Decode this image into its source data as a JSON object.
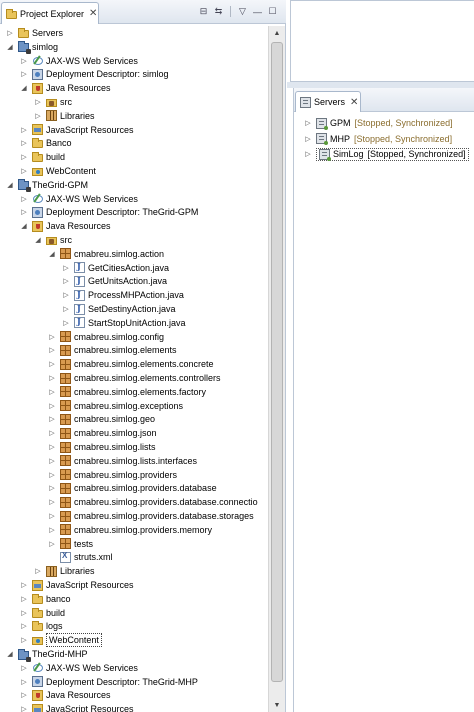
{
  "project_explorer": {
    "tab_label": "Project Explorer",
    "close_glyph": "✕",
    "toolbar": {
      "collapse_all": "⊟",
      "link_with_editor": "⇆",
      "view_menu": "▽",
      "minimize": "—",
      "maximize": "☐"
    },
    "tree": [
      {
        "depth": 0,
        "label": "Servers",
        "icon": "folder-icon",
        "expand": "collapsed"
      },
      {
        "depth": 0,
        "label": "simlog",
        "icon": "project-icon",
        "expand": "expanded"
      },
      {
        "depth": 1,
        "label": "JAX-WS Web Services",
        "icon": "web-services-icon",
        "expand": "collapsed"
      },
      {
        "depth": 1,
        "label": "Deployment Descriptor: simlog",
        "icon": "deployment-descriptor-icon",
        "expand": "collapsed"
      },
      {
        "depth": 1,
        "label": "Java Resources",
        "icon": "java-resources-icon",
        "expand": "expanded"
      },
      {
        "depth": 2,
        "label": "src",
        "icon": "source-folder-icon",
        "expand": "collapsed"
      },
      {
        "depth": 2,
        "label": "Libraries",
        "icon": "libraries-icon",
        "expand": "collapsed"
      },
      {
        "depth": 1,
        "label": "JavaScript Resources",
        "icon": "javascript-resources-icon",
        "expand": "collapsed"
      },
      {
        "depth": 1,
        "label": "Banco",
        "icon": "folder-icon",
        "expand": "collapsed"
      },
      {
        "depth": 1,
        "label": "build",
        "icon": "folder-icon",
        "expand": "collapsed"
      },
      {
        "depth": 1,
        "label": "WebContent",
        "icon": "web-content-icon",
        "expand": "collapsed"
      },
      {
        "depth": 0,
        "label": "TheGrid-GPM",
        "icon": "project-icon",
        "expand": "expanded"
      },
      {
        "depth": 1,
        "label": "JAX-WS Web Services",
        "icon": "web-services-icon",
        "expand": "collapsed"
      },
      {
        "depth": 1,
        "label": "Deployment Descriptor: TheGrid-GPM",
        "icon": "deployment-descriptor-icon",
        "expand": "collapsed"
      },
      {
        "depth": 1,
        "label": "Java Resources",
        "icon": "java-resources-icon",
        "expand": "expanded"
      },
      {
        "depth": 2,
        "label": "src",
        "icon": "source-folder-icon",
        "expand": "expanded"
      },
      {
        "depth": 3,
        "label": "cmabreu.simlog.action",
        "icon": "package-icon",
        "expand": "expanded"
      },
      {
        "depth": 4,
        "label": "GetCitiesAction.java",
        "icon": "java-file-icon",
        "expand": "collapsed"
      },
      {
        "depth": 4,
        "label": "GetUnitsAction.java",
        "icon": "java-file-icon",
        "expand": "collapsed"
      },
      {
        "depth": 4,
        "label": "ProcessMHPAction.java",
        "icon": "java-file-icon",
        "expand": "collapsed"
      },
      {
        "depth": 4,
        "label": "SetDestinyAction.java",
        "icon": "java-file-icon",
        "expand": "collapsed"
      },
      {
        "depth": 4,
        "label": "StartStopUnitAction.java",
        "icon": "java-file-icon",
        "expand": "collapsed"
      },
      {
        "depth": 3,
        "label": "cmabreu.simlog.config",
        "icon": "package-icon",
        "expand": "collapsed"
      },
      {
        "depth": 3,
        "label": "cmabreu.simlog.elements",
        "icon": "package-icon",
        "expand": "collapsed"
      },
      {
        "depth": 3,
        "label": "cmabreu.simlog.elements.concrete",
        "icon": "package-icon",
        "expand": "collapsed"
      },
      {
        "depth": 3,
        "label": "cmabreu.simlog.elements.controllers",
        "icon": "package-icon",
        "expand": "collapsed"
      },
      {
        "depth": 3,
        "label": "cmabreu.simlog.elements.factory",
        "icon": "package-icon",
        "expand": "collapsed"
      },
      {
        "depth": 3,
        "label": "cmabreu.simlog.exceptions",
        "icon": "package-icon",
        "expand": "collapsed"
      },
      {
        "depth": 3,
        "label": "cmabreu.simlog.geo",
        "icon": "package-icon",
        "expand": "collapsed"
      },
      {
        "depth": 3,
        "label": "cmabreu.simlog.json",
        "icon": "package-icon",
        "expand": "collapsed"
      },
      {
        "depth": 3,
        "label": "cmabreu.simlog.lists",
        "icon": "package-icon",
        "expand": "collapsed"
      },
      {
        "depth": 3,
        "label": "cmabreu.simlog.lists.interfaces",
        "icon": "package-icon",
        "expand": "collapsed"
      },
      {
        "depth": 3,
        "label": "cmabreu.simlog.providers",
        "icon": "package-icon",
        "expand": "collapsed"
      },
      {
        "depth": 3,
        "label": "cmabreu.simlog.providers.database",
        "icon": "package-icon",
        "expand": "collapsed"
      },
      {
        "depth": 3,
        "label": "cmabreu.simlog.providers.database.connectio",
        "icon": "package-icon",
        "expand": "collapsed"
      },
      {
        "depth": 3,
        "label": "cmabreu.simlog.providers.database.storages",
        "icon": "package-icon",
        "expand": "collapsed"
      },
      {
        "depth": 3,
        "label": "cmabreu.simlog.providers.memory",
        "icon": "package-icon",
        "expand": "collapsed"
      },
      {
        "depth": 3,
        "label": "tests",
        "icon": "package-icon",
        "expand": "collapsed"
      },
      {
        "depth": 3,
        "label": "struts.xml",
        "icon": "xml-file-icon",
        "expand": "none"
      },
      {
        "depth": 2,
        "label": "Libraries",
        "icon": "libraries-icon",
        "expand": "collapsed"
      },
      {
        "depth": 1,
        "label": "JavaScript Resources",
        "icon": "javascript-resources-icon",
        "expand": "collapsed"
      },
      {
        "depth": 1,
        "label": "banco",
        "icon": "folder-icon",
        "expand": "collapsed"
      },
      {
        "depth": 1,
        "label": "build",
        "icon": "folder-icon",
        "expand": "collapsed"
      },
      {
        "depth": 1,
        "label": "logs",
        "icon": "folder-icon",
        "expand": "collapsed"
      },
      {
        "depth": 1,
        "label": "WebContent",
        "icon": "web-content-icon",
        "expand": "collapsed",
        "selected": true
      },
      {
        "depth": 0,
        "label": "TheGrid-MHP",
        "icon": "project-icon",
        "expand": "expanded"
      },
      {
        "depth": 1,
        "label": "JAX-WS Web Services",
        "icon": "web-services-icon",
        "expand": "collapsed"
      },
      {
        "depth": 1,
        "label": "Deployment Descriptor: TheGrid-MHP",
        "icon": "deployment-descriptor-icon",
        "expand": "collapsed"
      },
      {
        "depth": 1,
        "label": "Java Resources",
        "icon": "java-resources-icon",
        "expand": "collapsed"
      },
      {
        "depth": 1,
        "label": "JavaScript Resources",
        "icon": "javascript-resources-icon",
        "expand": "collapsed"
      }
    ]
  },
  "servers_view": {
    "tab_label": "Servers",
    "close_glyph": "✕",
    "servers": [
      {
        "name": "GPM",
        "status": "[Stopped, Synchronized]",
        "selected": false
      },
      {
        "name": "MHP",
        "status": "[Stopped, Synchronized]",
        "selected": false
      },
      {
        "name": "SimLog",
        "status": "[Stopped, Synchronized]",
        "selected": true
      }
    ]
  },
  "scrollbar": {
    "up_glyph": "▲",
    "down_glyph": "▼"
  }
}
